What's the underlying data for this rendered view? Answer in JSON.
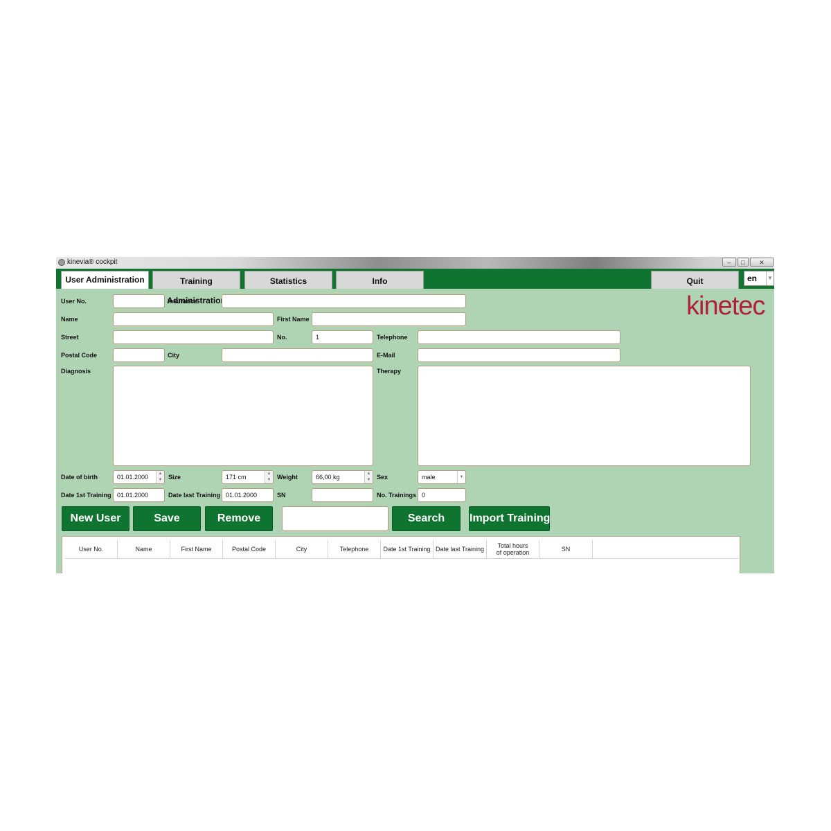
{
  "window": {
    "title": "kinevia® cockpit",
    "controls": {
      "minimize": "–",
      "maximize": "□",
      "close": "✕"
    }
  },
  "tabs": [
    {
      "label": "User Administration",
      "active": true
    },
    {
      "label": "Training Administration",
      "active": false
    },
    {
      "label": "Statistics",
      "active": false
    },
    {
      "label": "Info",
      "active": false
    }
  ],
  "quit_label": "Quit",
  "language": {
    "value": "en",
    "icon": "chevron-down-icon"
  },
  "logo": "kinetec",
  "form": {
    "user_no": {
      "label": "User No.",
      "value": ""
    },
    "insurance": {
      "label": "Insurance",
      "value": ""
    },
    "name": {
      "label": "Name",
      "value": ""
    },
    "first_name": {
      "label": "First Name",
      "value": ""
    },
    "street": {
      "label": "Street",
      "value": ""
    },
    "no": {
      "label": "No.",
      "value": "1"
    },
    "telephone": {
      "label": "Telephone",
      "value": ""
    },
    "postal_code": {
      "label": "Postal Code",
      "value": ""
    },
    "city": {
      "label": "City",
      "value": ""
    },
    "email": {
      "label": "E-Mail",
      "value": ""
    },
    "diagnosis": {
      "label": "Diagnosis",
      "value": ""
    },
    "therapy": {
      "label": "Therapy",
      "value": ""
    },
    "date_of_birth": {
      "label": "Date of birth",
      "value": "01.01.2000"
    },
    "size": {
      "label": "Size",
      "value": "171 cm"
    },
    "weight": {
      "label": "Weight",
      "value": "66,00 kg"
    },
    "sex": {
      "label": "Sex",
      "value": "male"
    },
    "date_first_training": {
      "label": "Date 1st Training",
      "value": "01.01.2000"
    },
    "date_last_training": {
      "label": "Date last Training",
      "value": "01.01.2000"
    },
    "sn": {
      "label": "SN",
      "value": ""
    },
    "no_trainings": {
      "label": "No. Trainings",
      "value": "0"
    }
  },
  "buttons": {
    "new_user": "New User",
    "save": "Save",
    "remove": "Remove",
    "search": "Search",
    "import_training": "Import Training"
  },
  "search": {
    "value": ""
  },
  "table": {
    "columns": [
      "User No.",
      "Name",
      "First Name",
      "Postal Code",
      "City",
      "Telephone",
      "Date 1st Training",
      "Date last Training",
      "Total hours\nof operation",
      "SN"
    ],
    "rows": []
  },
  "colors": {
    "background": "#aed4b3",
    "accent": "#0e7430",
    "logo": "#b01f3b"
  }
}
